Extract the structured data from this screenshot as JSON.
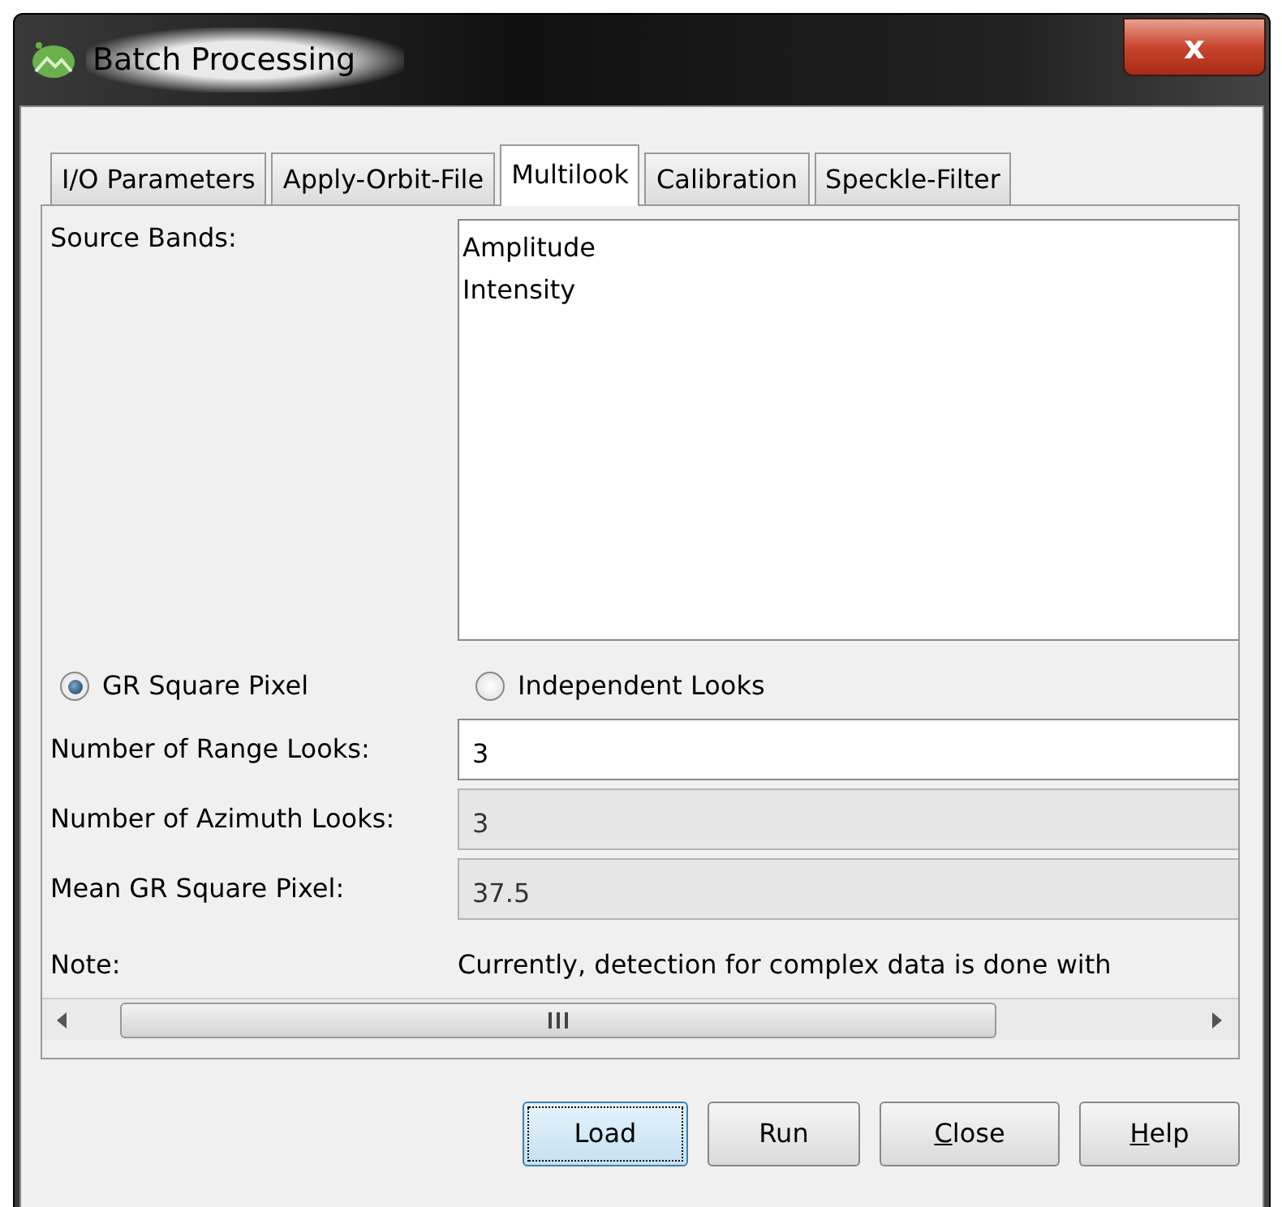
{
  "window": {
    "title": "Batch Processing",
    "close": "x"
  },
  "tabs": [
    {
      "label": "I/O Parameters",
      "selected": false
    },
    {
      "label": "Apply-Orbit-File",
      "selected": false
    },
    {
      "label": "Multilook",
      "selected": true
    },
    {
      "label": "Calibration",
      "selected": false
    },
    {
      "label": "Speckle-Filter",
      "selected": false
    }
  ],
  "source_bands": {
    "label": "Source Bands:",
    "items": [
      "Amplitude",
      "Intensity"
    ]
  },
  "options": [
    {
      "label": "GR Square Pixel",
      "selected": true
    },
    {
      "label": "Independent Looks",
      "selected": false
    }
  ],
  "fields": [
    {
      "label": "Number of Range Looks:",
      "value": "3",
      "disabled": false
    },
    {
      "label": "Number of Azimuth Looks:",
      "value": "3",
      "disabled": true
    },
    {
      "label": "Mean GR Square Pixel:",
      "value": "37.5",
      "disabled": true
    }
  ],
  "note": {
    "label": "Note:",
    "text": "Currently, detection for complex data is done with"
  },
  "buttons": [
    {
      "label": "Load",
      "focused": true
    },
    {
      "label": "Run",
      "focused": false
    },
    {
      "parts": [
        {
          "text": "C",
          "underlined": true
        },
        {
          "text": "lose",
          "underlined": false
        }
      ],
      "focused": false
    },
    {
      "parts": [
        {
          "text": "H",
          "underlined": true
        },
        {
          "text": "elp",
          "underlined": false
        }
      ],
      "focused": false
    }
  ]
}
